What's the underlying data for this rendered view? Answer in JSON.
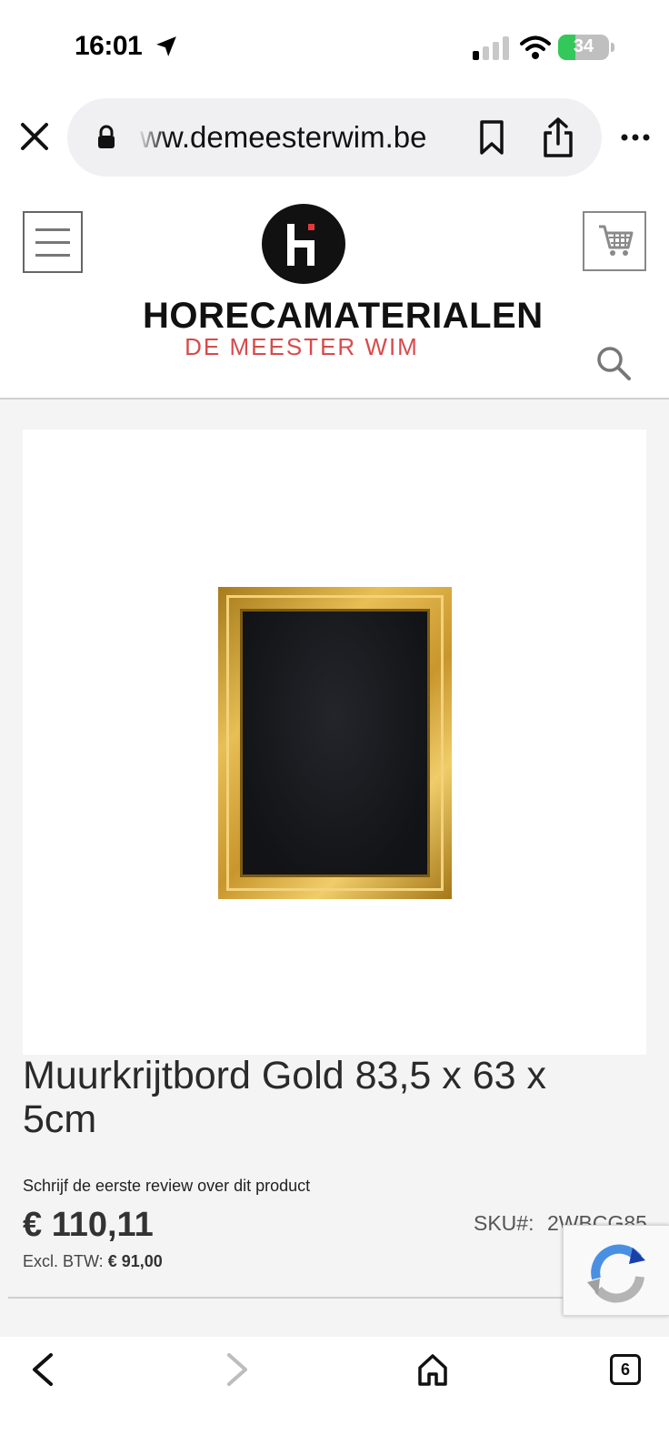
{
  "status_bar": {
    "time": "16:01",
    "battery": {
      "label": "34",
      "level": 0.34,
      "color": "#34c759"
    }
  },
  "browser": {
    "url": "ww.demeesterwim.be",
    "icons": [
      "close-icon",
      "lock-icon",
      "bookmark-icon",
      "share-icon",
      "more-icon"
    ]
  },
  "site": {
    "logo_title": "HORECAMATERIALEN",
    "logo_subtitle": "DE MEESTER WIM",
    "accent_color": "#d94a4a",
    "icons": [
      "hamburger-menu-icon",
      "cart-icon",
      "search-icon"
    ]
  },
  "product": {
    "title": "Muurkrijtbord Gold 83,5 x 63 x 5cm",
    "review_link": "Schrijf de eerste review over dit product",
    "price": "€ 110,11",
    "excl_label": "Excl. BTW:",
    "excl_value": "€ 91,00",
    "sku_label": "SKU#:",
    "sku_value": "2WBCG85"
  },
  "toolbar": {
    "tab_count": "6",
    "icons": [
      "back-icon",
      "forward-icon",
      "home-icon",
      "tabs-icon"
    ]
  }
}
